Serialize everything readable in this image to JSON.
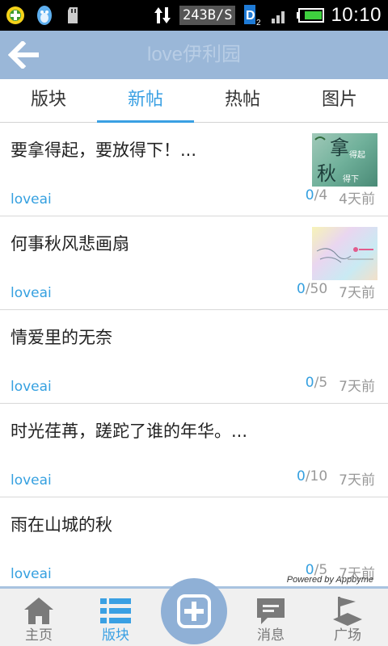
{
  "status_bar": {
    "speed": "243B/S",
    "time": "10:10",
    "icons": [
      "qq-browser-icon",
      "qq-penguin-icon",
      "sd-card-icon",
      "data-transfer-icon",
      "signal-icon",
      "sim-icon",
      "battery-icon"
    ]
  },
  "header": {
    "title": "love伊利园",
    "back_icon": "arrow-left-icon"
  },
  "tabs": [
    {
      "label": "版块",
      "active": false
    },
    {
      "label": "新帖",
      "active": true
    },
    {
      "label": "热帖",
      "active": false
    },
    {
      "label": "图片",
      "active": false
    }
  ],
  "posts": [
    {
      "title": "要拿得起，要放得下！...",
      "author": "loveai",
      "replies": "0",
      "views": "/4",
      "time": "4天前",
      "has_thumb": true
    },
    {
      "title": "何事秋风悲画扇",
      "author": "loveai",
      "replies": "0",
      "views": "/50",
      "time": "7天前",
      "has_thumb": true
    },
    {
      "title": "情爱里的无奈",
      "author": "loveai",
      "replies": "0",
      "views": "/5",
      "time": "7天前",
      "has_thumb": false
    },
    {
      "title": "时光荏苒，蹉跎了谁的年华。...",
      "author": "loveai",
      "replies": "0",
      "views": "/10",
      "time": "7天前",
      "has_thumb": false
    },
    {
      "title": "雨在山城的秋",
      "author": "loveai",
      "replies": "0",
      "views": "/5",
      "time": "7天前",
      "has_thumb": false
    }
  ],
  "thumb1_text": {
    "big1": "拿",
    "small1": "得起",
    "big2": "秋",
    "small2": "得下"
  },
  "powered_by": "Powered by Appbyme",
  "bottom_nav": [
    {
      "label": "主页",
      "icon": "home-icon",
      "active": false
    },
    {
      "label": "版块",
      "icon": "list-icon",
      "active": true
    },
    {
      "label": "",
      "icon": "add-icon",
      "active": false
    },
    {
      "label": "消息",
      "icon": "message-icon",
      "active": false
    },
    {
      "label": "广场",
      "icon": "square-icon",
      "active": false
    }
  ],
  "colors": {
    "accent": "#3aa0e3",
    "header_bg": "#9ab7d8",
    "center_button": "#8fb0d6"
  }
}
